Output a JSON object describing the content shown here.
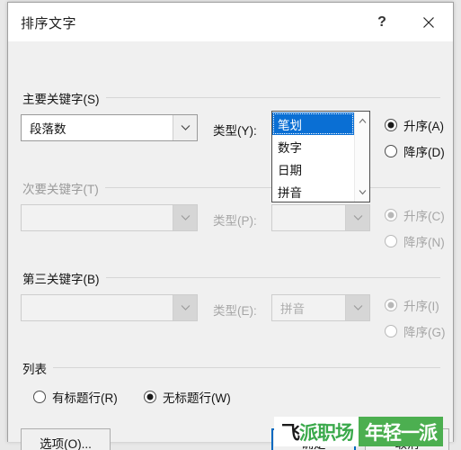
{
  "window": {
    "title": "排序文字",
    "help_label": "?",
    "close_label": "✕"
  },
  "groups": {
    "primary": {
      "label": "主要关键字(S)",
      "field_value": "段落数",
      "type_label": "类型(Y):",
      "type_value": "拼音",
      "asc_label": "升序(A)",
      "desc_label": "降序(D)",
      "selected_order": "asc"
    },
    "secondary": {
      "label": "次要关键字(T)",
      "field_value": "",
      "type_label": "类型(P):",
      "type_value": "",
      "asc_label": "升序(C)",
      "desc_label": "降序(N)",
      "selected_order": "asc",
      "disabled": true
    },
    "third": {
      "label": "第三关键字(B)",
      "field_value": "",
      "type_label": "类型(E):",
      "type_value": "拼音",
      "asc_label": "升序(I)",
      "desc_label": "降序(G)",
      "selected_order": "asc",
      "disabled": true
    },
    "list": {
      "label": "列表",
      "with_header_label": "有标题行(R)",
      "no_header_label": "无标题行(W)",
      "selected": "no_header"
    }
  },
  "dropdown": {
    "open": true,
    "items": [
      "笔划",
      "数字",
      "日期",
      "拼音"
    ],
    "selected_index": 0,
    "scroll_up_glyph": "⌃",
    "scroll_down_glyph": "⌄"
  },
  "buttons": {
    "options": "选项(O)...",
    "ok": "确定",
    "cancel": "取消"
  },
  "watermark": {
    "left_first": "飞",
    "left_rest": "派职场",
    "right": "年轻一派",
    "green": "#4caf50"
  }
}
